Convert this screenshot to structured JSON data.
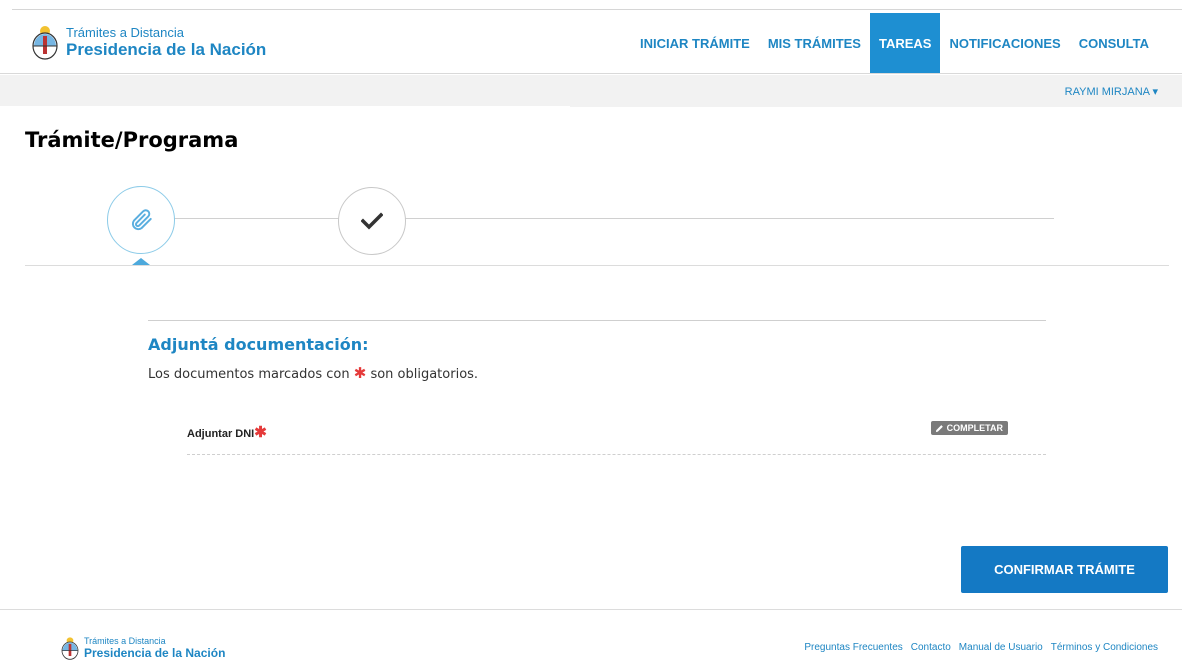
{
  "brand": {
    "line1": "Trámites a Distancia",
    "line2": "Presidencia de la Nación"
  },
  "nav": [
    {
      "label": "INICIAR TRÁMITE",
      "active": false
    },
    {
      "label": "MIS TRÁMITES",
      "active": false
    },
    {
      "label": "TAREAS",
      "active": true
    },
    {
      "label": "NOTIFICACIONES",
      "active": false
    },
    {
      "label": "CONSULTA",
      "active": false
    }
  ],
  "user": {
    "name": "RAYMI MIRJANA",
    "caret": "▾"
  },
  "page": {
    "title": "Trámite/Programa"
  },
  "stepper": {
    "steps": [
      {
        "icon": "paperclip-icon",
        "current": true
      },
      {
        "icon": "checkmark-icon",
        "current": false
      }
    ]
  },
  "documents": {
    "title": "Adjuntá documentación:",
    "note_before": "Los documentos marcados con",
    "required_mark": "✱",
    "note_after": "son obligatorios.",
    "items": [
      {
        "label": "Adjuntar DNI",
        "required": true,
        "action": "COMPLETAR"
      }
    ]
  },
  "actions": {
    "confirm": "CONFIRMAR TRÁMITE"
  },
  "footer": {
    "brand": {
      "line1": "Trámites a Distancia",
      "line2": "Presidencia de la Nación"
    },
    "links": [
      "Preguntas Frecuentes",
      "Contacto",
      "Manual de Usuario",
      "Términos y Condiciones"
    ]
  },
  "colors": {
    "accent": "#1e86c3",
    "active_nav": "#1e8fd2",
    "primary_button": "#1479c4",
    "required": "#e53a3a"
  }
}
